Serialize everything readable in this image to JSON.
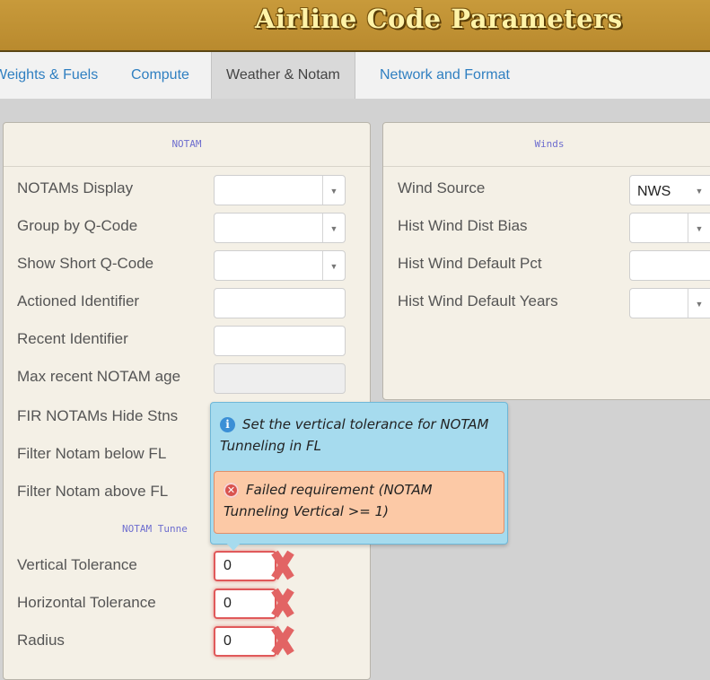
{
  "app": {
    "title": "Airline Code Parameters"
  },
  "tabs": [
    {
      "label": "Weights & Fuels",
      "active": false
    },
    {
      "label": "Compute",
      "active": false
    },
    {
      "label": "Weather & Notam",
      "active": true
    },
    {
      "label": "Network and Format",
      "active": false
    }
  ],
  "notam": {
    "title": "NOTAM",
    "fields": [
      {
        "label": "NOTAMs Display",
        "type": "select",
        "value": ""
      },
      {
        "label": "Group by Q-Code",
        "type": "select",
        "value": ""
      },
      {
        "label": "Show Short Q-Code",
        "type": "select",
        "value": ""
      },
      {
        "label": "Actioned Identifier",
        "type": "text",
        "value": ""
      },
      {
        "label": "Recent Identifier",
        "type": "text",
        "value": ""
      },
      {
        "label": "Max recent NOTAM age",
        "type": "text",
        "value": "",
        "disabled": true
      },
      {
        "label": "FIR NOTAMs Hide Stns",
        "type": "hidden"
      },
      {
        "label": "Filter Notam below FL",
        "type": "hidden"
      },
      {
        "label": "Filter Notam above FL",
        "type": "hidden"
      }
    ],
    "tunneling_title": "NOTAM Tunne",
    "tunneling_fields": [
      {
        "label": "Vertical Tolerance",
        "value": "0"
      },
      {
        "label": "Horizontal Tolerance",
        "value": "0"
      },
      {
        "label": "Radius",
        "value": "0"
      }
    ]
  },
  "winds": {
    "title": "Winds",
    "fields": [
      {
        "label": "Wind Source",
        "type": "select",
        "value": "NWS"
      },
      {
        "label": "Hist Wind Dist Bias",
        "type": "select",
        "value": ""
      },
      {
        "label": "Hist Wind Default Pct",
        "type": "text",
        "value": ""
      },
      {
        "label": "Hist Wind Default Years",
        "type": "select",
        "value": ""
      }
    ]
  },
  "tooltip": {
    "info_text": "Set the vertical tolerance for NOTAM Tunneling in FL",
    "error_text": "Failed requirement (NOTAM Tunneling Vertical >= 1)"
  },
  "icons": {
    "info": "info-icon",
    "error": "error-icon",
    "invalid": "invalid-x-icon",
    "dropdown": "chevron-down-icon"
  },
  "colors": {
    "header": "#c89a3b",
    "link": "#2f7fc1",
    "panel": "#f4f0e6",
    "tooltip": "#a6dbee",
    "error_box": "#fcc9a6",
    "error_border": "#e0595a"
  }
}
